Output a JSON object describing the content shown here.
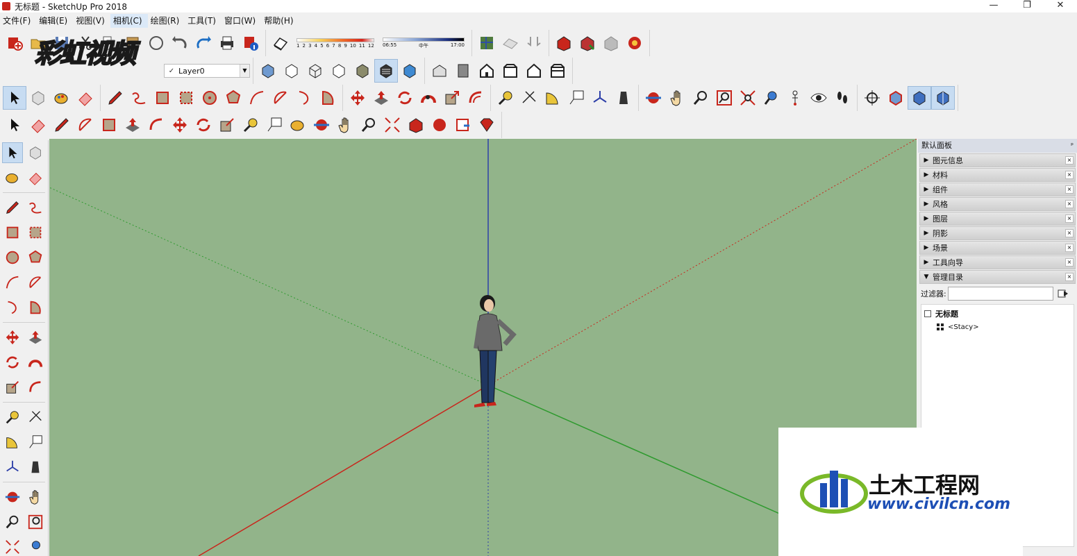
{
  "window": {
    "title": "无标题 - SketchUp Pro 2018",
    "controls": [
      "—",
      "❐",
      "✕"
    ]
  },
  "menubar": [
    {
      "label": "文件(F)"
    },
    {
      "label": "编辑(E)"
    },
    {
      "label": "视图(V)"
    },
    {
      "label": "相机(C)"
    },
    {
      "label": "绘图(R)"
    },
    {
      "label": "工具(T)"
    },
    {
      "label": "窗口(W)"
    },
    {
      "label": "帮助(H)"
    }
  ],
  "toolbar": {
    "layer": {
      "check": "✓",
      "value": "Layer0"
    },
    "shadow_months": [
      "1",
      "2",
      "3",
      "4",
      "5",
      "6",
      "7",
      "8",
      "9",
      "10",
      "11",
      "12"
    ],
    "shadow_time": {
      "start": "06:55",
      "mid": "中午",
      "end": "17:00"
    }
  },
  "tray": {
    "title": "默认面板",
    "pin": "ᵖ",
    "panels": [
      {
        "label": "图元信息",
        "expanded": false
      },
      {
        "label": "材料",
        "expanded": false
      },
      {
        "label": "组件",
        "expanded": false
      },
      {
        "label": "风格",
        "expanded": false
      },
      {
        "label": "图层",
        "expanded": false
      },
      {
        "label": "阴影",
        "expanded": false
      },
      {
        "label": "场景",
        "expanded": false
      },
      {
        "label": "工具向导",
        "expanded": false
      },
      {
        "label": "管理目录",
        "expanded": true
      }
    ],
    "collapsed_arrow": "▶",
    "expanded_arrow": "▼",
    "close_glyph": "×",
    "filter_label": "过滤器:",
    "filter_value": "",
    "outliner": {
      "root": "无标题",
      "children": [
        "<Stacy>"
      ]
    }
  },
  "watermarks": {
    "top_left": "彩虹视频",
    "bottom_right_cn": "土木工程网",
    "bottom_right_url": "www.civilcn.com"
  },
  "colors": {
    "viewport_bg": "#92b48a",
    "axis_red": "#c8261c",
    "axis_green": "#2e9a2e",
    "axis_blue": "#2c3ea8",
    "menu_highlight": "#dbe9f8"
  }
}
